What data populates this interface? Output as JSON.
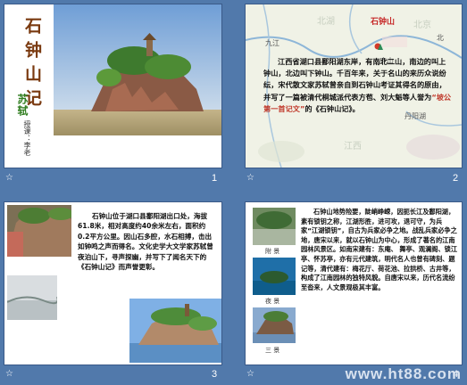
{
  "slide1": {
    "title": "石钟山记",
    "author": "苏轼",
    "lecturer": "授课：李老",
    "number": "1"
  },
  "slide2": {
    "map_label_place": "石钟山",
    "map_label_city": "九江",
    "map_label_mountain": "庐山",
    "map_label_area": "丹阳湖",
    "map_label_north": "北",
    "map_label_faded_1": "北湖",
    "map_label_faded_2": "北京",
    "map_label_faded_3": "江西",
    "body_intro": "江西省湖口县鄱阳湖东岸，有南北二山，南边的叫上钟山，北边叫下钟山。千百年来，关于名山的来历众说纷纭，宋代散文家苏轼曾亲自到石钟山考证其得名的原由，并写了一篇被清代桐城派代表方苞、刘大魁等人誉为",
    "body_quote": "“坡公第一首记文”",
    "body_end": "的《石钟山记》。",
    "number": "2"
  },
  "slide3": {
    "body": "石钟山位于湖口县鄱阳湖出口处，海拔61.8米，相对高度约40余米左右，面积约0.2平方公里。因山石多腔，水石相搏，击出如钟鸣之声而得名。文化史学大文学家苏轼曾夜泊山下，寻声探幽，并写下了闻名天下的《石钟山记》而声誉更彰。",
    "number": "3"
  },
  "slide4": {
    "body": "石钟山地势险要，陡峭峥嵘，因扼长江及鄱阳湖，素有锁钥之称，江湖形胜，进可攻，退可守，为兵家“江湖锁钥”，自古为兵家必争之地。战乱兵家必争之地，唐宋以来，就以石钟山为中心，形成了著名的江南园林风景区。如南宋建有：东庵、 舞亭、观澜阁、锁江亭、怀苏亭，亦有元代建筑，明代名人也曾有碑刻、题记等，清代建有：梅花厅、荷花池、拉拱桥、古井等，构成了江南园林的独特风貌。自唐宋以来，历代名流纷至沓来，人文景观极其丰富。",
    "caption_1": "附 景",
    "caption_2": "夜 景",
    "caption_3": "三 景",
    "number": "4"
  },
  "footer": {
    "watermark": "www.ht88.com"
  },
  "icons": {
    "slide_star": "☆"
  }
}
